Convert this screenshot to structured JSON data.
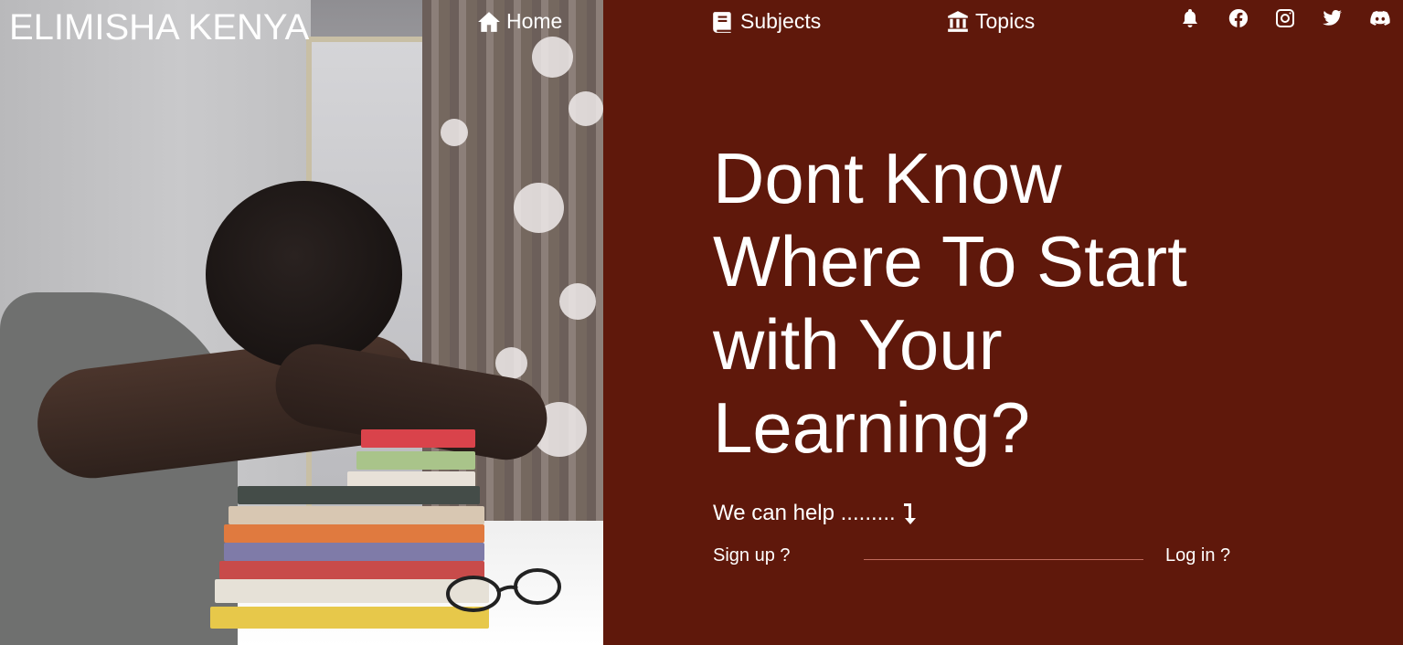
{
  "brand": {
    "name": "ELIMISHA KENYA"
  },
  "nav": {
    "items": [
      {
        "label": "Home",
        "icon": "home-icon"
      },
      {
        "label": "Subjects",
        "icon": "book-icon"
      },
      {
        "label": "Topics",
        "icon": "institution-icon"
      }
    ],
    "social_icons": [
      "bell-icon",
      "facebook-icon",
      "instagram-icon",
      "twitter-icon",
      "discord-icon"
    ]
  },
  "hero": {
    "headline_lines": [
      "Dont Know",
      "Where To Start",
      "with Your",
      "Learning?"
    ],
    "help_text": "We can help .........",
    "help_icon": "arrow-down-icon",
    "signup_label": "Sign up ?",
    "login_label": "Log in ?"
  },
  "colors": {
    "background": "#5f180b",
    "text": "#ffffff"
  }
}
